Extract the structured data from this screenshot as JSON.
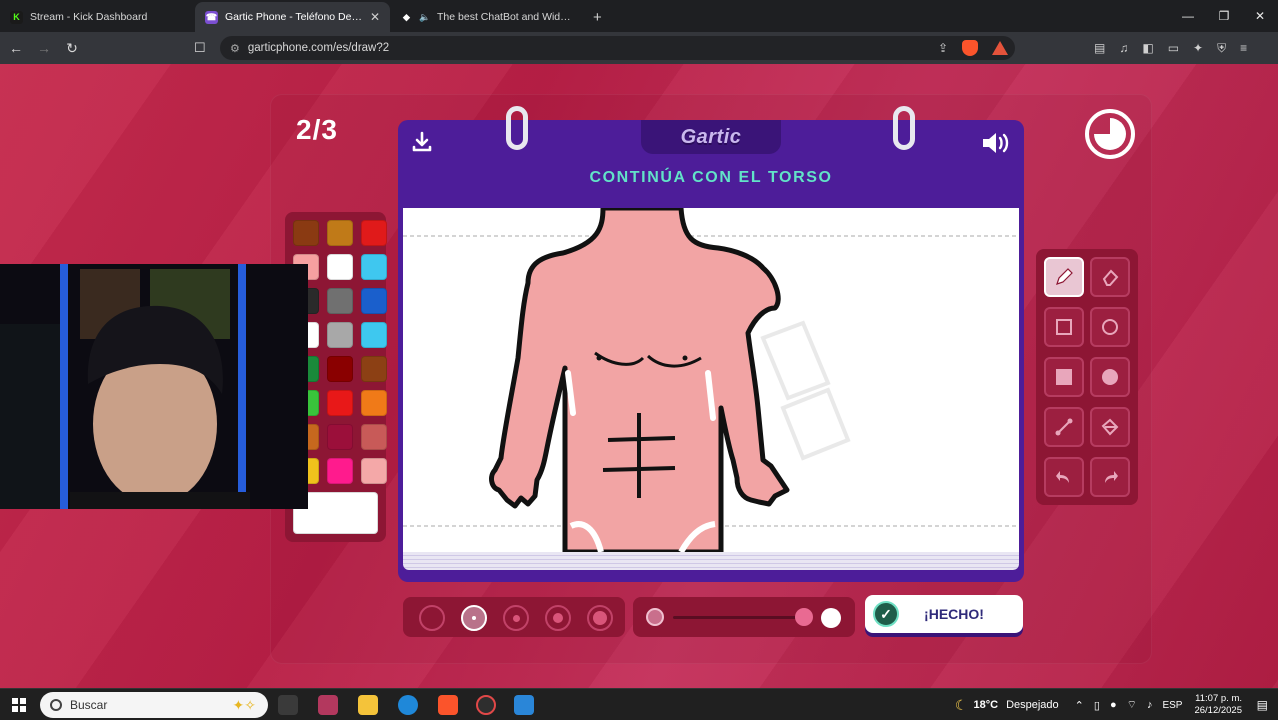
{
  "browser": {
    "tabs": [
      {
        "title": "Stream - Kick Dashboard",
        "favicon": "kick-icon",
        "active": false
      },
      {
        "title": "Gartic Phone - Teléfono Descom",
        "favicon": "gartic-icon",
        "active": true
      },
      {
        "title": "The best ChatBot and Widgets fo",
        "favicon": "diamond-icon",
        "active": false
      }
    ],
    "new_tab": "+",
    "url": "garticphone.com/es/draw?2"
  },
  "game": {
    "round": "2/3",
    "logo": "Gartic",
    "prompt": "CONTINÚA CON EL TORSO",
    "done_label": "¡HECHO!",
    "palette": [
      "#8a3a12",
      "#c07a18",
      "#e01a1a",
      "#f6a0a0",
      "#ffffff",
      "#3fc7ef",
      "#2a2a2a",
      "#707070",
      "#1a5fcc",
      "#ffffff",
      "#a8a8a8",
      "#3ec8ef",
      "#1a8a3a",
      "#8a0000",
      "#8c4014",
      "#39c43b",
      "#e81818",
      "#f07a18",
      "#c6681e",
      "#9b0f3a",
      "#c85a58",
      "#f0c21c",
      "#ff1b8d",
      "#f4a8a8"
    ],
    "current_color": "#ffffff",
    "brush_sizes": 5,
    "selected_size_index": 1,
    "selected_tool": "pencil",
    "timer_remaining": 0.75,
    "accent": "#4d1d99"
  },
  "taskbar": {
    "search_placeholder": "Buscar",
    "weather_temp": "18°C",
    "weather_text": "Despejado",
    "language": "ESP",
    "time": "11:07 p. m.",
    "date": "26/12/2025"
  }
}
